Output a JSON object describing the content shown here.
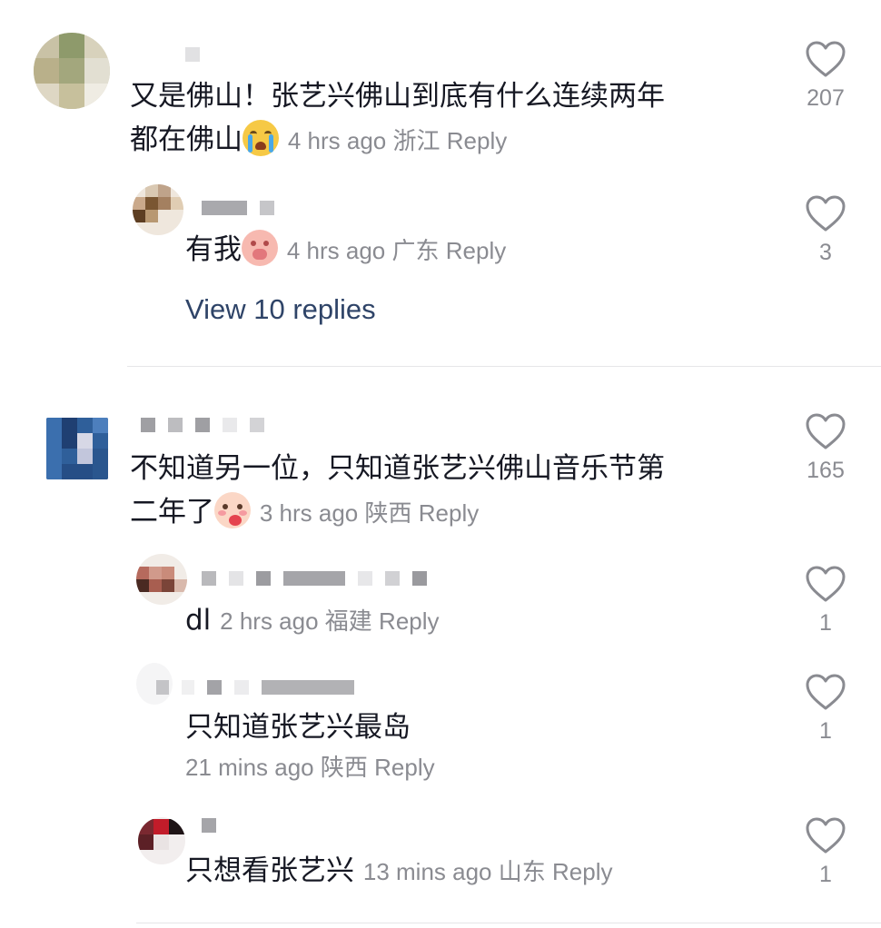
{
  "comments": [
    {
      "text_line1": "又是佛山！张艺兴佛山到底有什么连续两年",
      "text_line2": "都在佛山",
      "emoji": "loudly-crying-face",
      "time": "4 hrs ago",
      "location": "浙江",
      "reply_label": "Reply",
      "likes": "207",
      "replies": [
        {
          "text": "有我",
          "emoji": "pig-face",
          "time": "4 hrs ago",
          "location": "广东",
          "reply_label": "Reply",
          "likes": "3"
        }
      ],
      "view_replies": "View 10 replies"
    },
    {
      "text_line1": "不知道另一位，只知道张艺兴佛山音乐节第",
      "text_line2": "二年了",
      "emoji": "blushing-face",
      "time": "3 hrs ago",
      "location": "陕西",
      "reply_label": "Reply",
      "likes": "165",
      "replies": [
        {
          "text": "dl",
          "time": "2 hrs ago",
          "location": "福建",
          "reply_label": "Reply",
          "likes": "1"
        },
        {
          "text": "只知道张艺兴最岛",
          "time": "21 mins ago",
          "location": "陕西",
          "reply_label": "Reply",
          "likes": "1"
        },
        {
          "text": "只想看张艺兴",
          "time": "13 mins ago",
          "location": "山东",
          "reply_label": "Reply",
          "likes": "1"
        }
      ]
    }
  ],
  "colors": {
    "meta": "#8a8b91",
    "link": "#2f4468",
    "text": "#161823"
  },
  "icons": {
    "like": "heart-outline-icon"
  }
}
